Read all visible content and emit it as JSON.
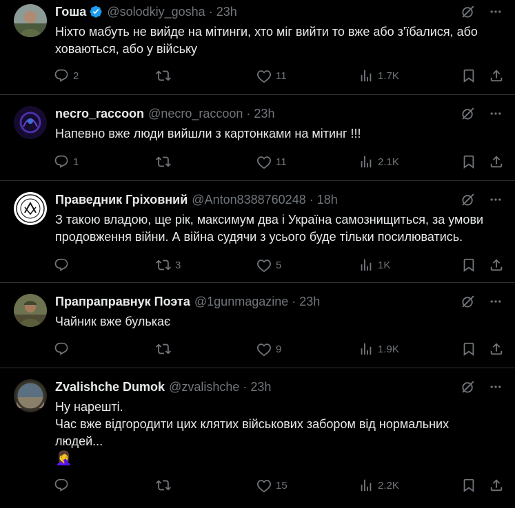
{
  "tweets": [
    {
      "name": "Гоша",
      "handle": "@solodkiy_gosha",
      "time": "23h",
      "verified": true,
      "lines": [
        "Ніхто мабуть не вийде на мітинги, хто міг вийти то вже або з'їбалися, або",
        "ховаються, або у війську"
      ],
      "replies": "2",
      "retweets": "",
      "likes": "11",
      "views": "1.7K"
    },
    {
      "name": "necro_raccoon",
      "handle": "@necro_raccoon",
      "time": "23h",
      "verified": false,
      "lines": [
        "Напевно вже люди вийшли з картонками на мітинг !!!"
      ],
      "replies": "1",
      "retweets": "",
      "likes": "11",
      "views": "2.1K"
    },
    {
      "name": "Праведник Гріховний",
      "handle": "@Anton8388760248",
      "time": "18h",
      "verified": false,
      "lines": [
        "З такою владою, ще рік, максимум два і Україна самознищиться, за умови",
        "продовження війни. А війна судячи з усього буде тільки посилюватись."
      ],
      "replies": "",
      "retweets": "3",
      "likes": "5",
      "views": "1K"
    },
    {
      "name": "Прапраправнук Поэта",
      "handle": "@1gunmagazine",
      "time": "23h",
      "verified": false,
      "lines": [
        "Чайник вже булькає"
      ],
      "replies": "",
      "retweets": "",
      "likes": "9",
      "views": "1.9K"
    },
    {
      "name": "Zvalishche Dumok",
      "handle": "@zvalishche",
      "time": "23h",
      "verified": false,
      "lines": [
        "Ну нарешті.",
        "Час вже відгородити цих клятих військових забором від нормальних",
        "людей..."
      ],
      "emoji": "🤦‍♀️",
      "replies": "",
      "retweets": "",
      "likes": "15",
      "views": "2.2K"
    }
  ],
  "colors": {
    "background": "#000000",
    "text": "#e7e9ea",
    "secondary": "#71767b",
    "border": "#2f3336",
    "verified": "#1d9bf0"
  },
  "icons": [
    "reply-icon",
    "retweet-icon",
    "like-icon",
    "views-icon",
    "bookmark-icon",
    "share-icon",
    "grok-icon",
    "more-icon",
    "verified-badge-icon"
  ]
}
